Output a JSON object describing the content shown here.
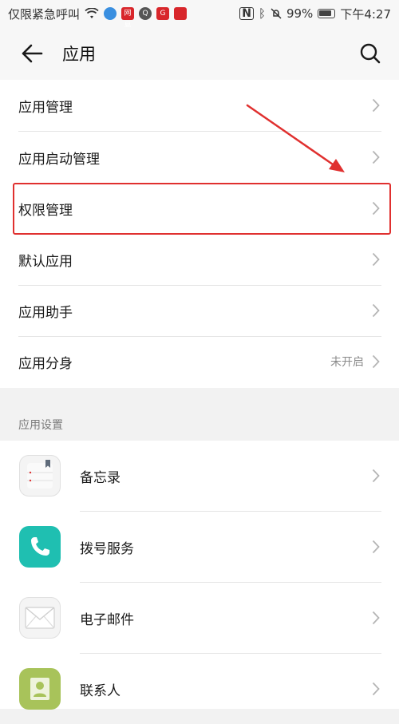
{
  "status_bar": {
    "carrier": "仅限紧急呼叫",
    "battery": "99%",
    "time": "下午4:27",
    "icon_labels": [
      "网易",
      "Q",
      "G"
    ]
  },
  "app_bar": {
    "title": "应用"
  },
  "menu": {
    "items": [
      {
        "label": "应用管理",
        "value": ""
      },
      {
        "label": "应用启动管理",
        "value": ""
      },
      {
        "label": "权限管理",
        "value": ""
      },
      {
        "label": "默认应用",
        "value": ""
      },
      {
        "label": "应用助手",
        "value": ""
      },
      {
        "label": "应用分身",
        "value": "未开启"
      }
    ]
  },
  "app_settings": {
    "header": "应用设置",
    "apps": [
      {
        "label": "备忘录",
        "icon": "notes-icon",
        "color": "#f4f4f4"
      },
      {
        "label": "拨号服务",
        "icon": "phone-icon",
        "color": "#1fbfb1"
      },
      {
        "label": "电子邮件",
        "icon": "mail-icon",
        "color": "#f4f4f4"
      },
      {
        "label": "联系人",
        "icon": "contacts-icon",
        "color": "#a8c35a"
      }
    ]
  },
  "colors": {
    "highlight": "#e0302f",
    "background": "#f2f2f2",
    "text_secondary": "#8a8a8a"
  }
}
